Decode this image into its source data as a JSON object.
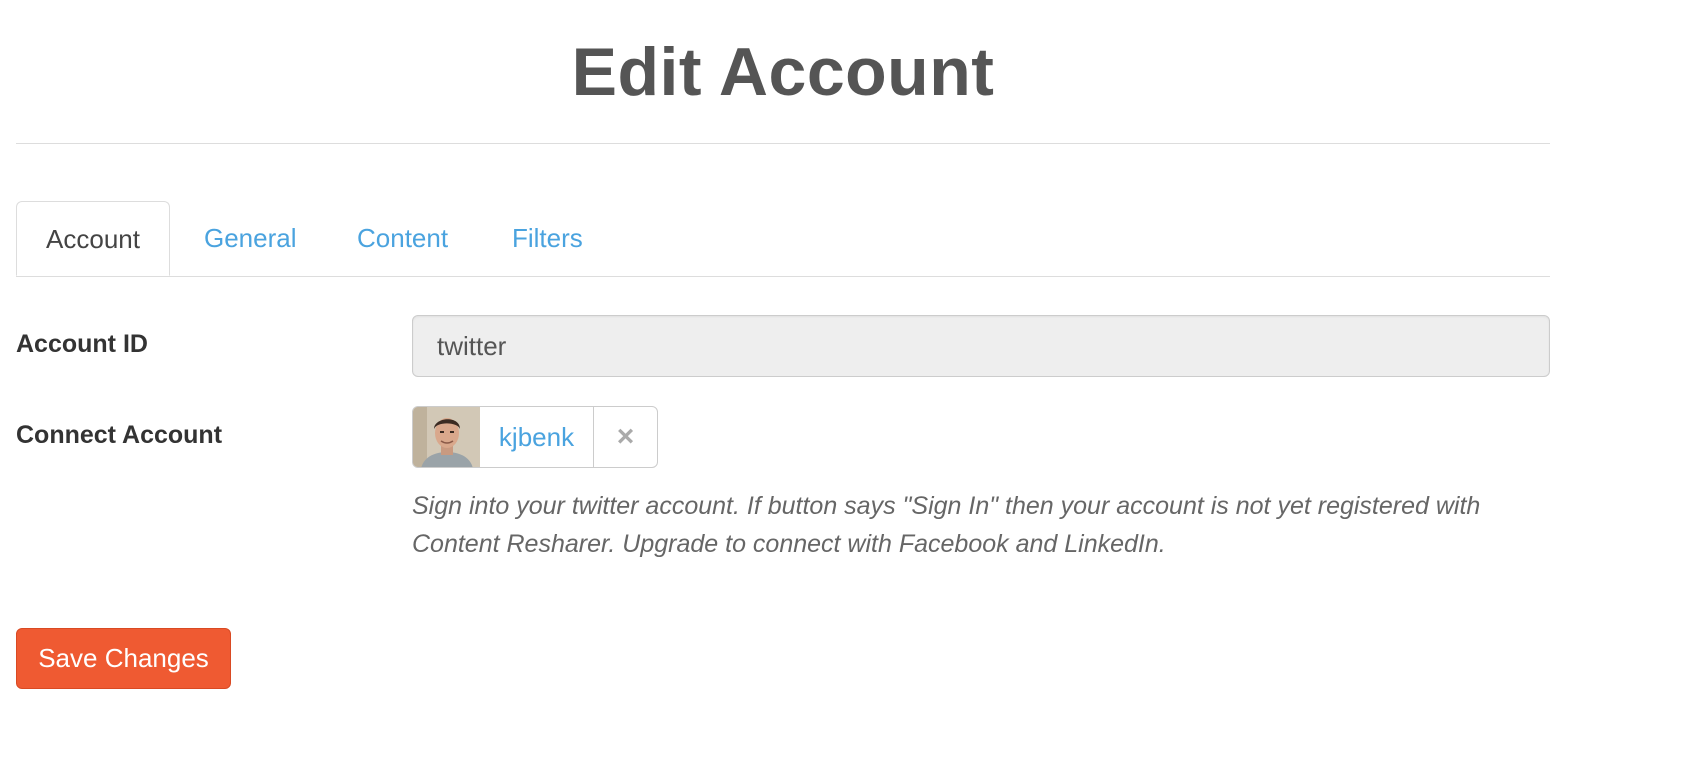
{
  "page": {
    "title": "Edit Account"
  },
  "tabs": [
    {
      "label": "Account",
      "active": true
    },
    {
      "label": "General",
      "active": false
    },
    {
      "label": "Content",
      "active": false
    },
    {
      "label": "Filters",
      "active": false
    }
  ],
  "form": {
    "account_id": {
      "label": "Account ID",
      "value": "twitter"
    },
    "connect_account": {
      "label": "Connect Account",
      "username": "kjbenk",
      "disconnect_icon": "close-icon",
      "help_text": "Sign into your twitter account. If button says \"Sign In\" then your account is not yet registered with Content Resharer. Upgrade to connect with Facebook and LinkedIn."
    }
  },
  "actions": {
    "save_label": "Save Changes"
  },
  "colors": {
    "link": "#4aa3df",
    "primary_button": "#ef5a32",
    "input_disabled_bg": "#eeeeee"
  }
}
